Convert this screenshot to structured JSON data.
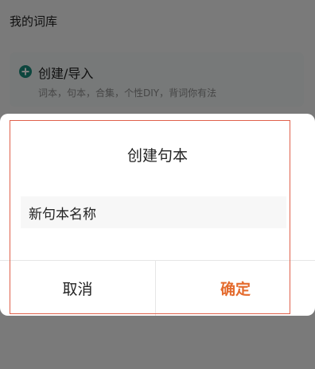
{
  "page": {
    "title": "我的词库"
  },
  "create_card": {
    "icon": "plus-circle-icon",
    "title": "创建/导入",
    "subtitle": "词本，句本，合集，个性DIY，背词你有法"
  },
  "dialog": {
    "title": "创建句本",
    "input_value": "新句本名称",
    "cancel_label": "取消",
    "confirm_label": "确定"
  },
  "colors": {
    "accent": "#1a8c7d",
    "confirm": "#e46b2e",
    "highlight_frame": "#e0614b",
    "caret": "#19a15a"
  }
}
